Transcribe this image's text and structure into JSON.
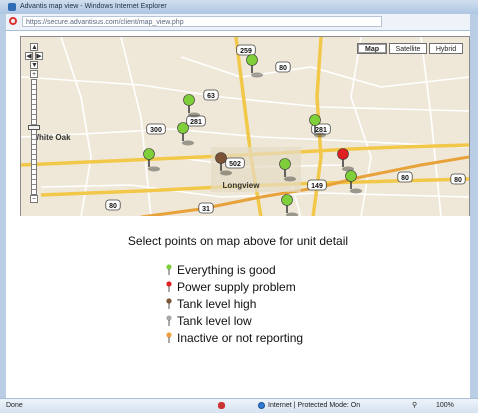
{
  "window": {
    "title": "Advantis map view - Windows Internet Explorer",
    "url": "https://secure.advantisus.com/client/map_view.php"
  },
  "map": {
    "types": [
      "Map",
      "Satellite",
      "Hybrid"
    ],
    "active_type": "Map",
    "zoom_in": "+",
    "zoom_out": "−",
    "labels": [
      {
        "text": "259",
        "kind": "shield"
      },
      {
        "text": "80",
        "kind": "shield"
      },
      {
        "text": "63",
        "kind": "shield"
      },
      {
        "text": "281",
        "kind": "shield"
      },
      {
        "text": "300",
        "kind": "shield"
      },
      {
        "text": "281",
        "kind": "shield"
      },
      {
        "text": "502",
        "kind": "shield"
      },
      {
        "text": "149",
        "kind": "shield"
      },
      {
        "text": "80",
        "kind": "shield"
      },
      {
        "text": "80",
        "kind": "shield"
      },
      {
        "text": "31",
        "kind": "shield"
      },
      {
        "text": "80",
        "kind": "shield"
      },
      {
        "text": "Longview",
        "kind": "city"
      },
      {
        "text": "White Oak",
        "kind": "city"
      }
    ],
    "markers": [
      {
        "status": "good"
      },
      {
        "status": "good"
      },
      {
        "status": "good"
      },
      {
        "status": "good"
      },
      {
        "status": "good"
      },
      {
        "status": "tank_high"
      },
      {
        "status": "good"
      },
      {
        "status": "good"
      },
      {
        "status": "power"
      },
      {
        "status": "good"
      }
    ]
  },
  "content": {
    "prompt": "Select points on map above for unit detail",
    "legend": [
      {
        "label": "Everything is good",
        "color": "#7fcf3a",
        "status": "good"
      },
      {
        "label": "Power supply problem",
        "color": "#e02020",
        "status": "power"
      },
      {
        "label": "Tank level high",
        "color": "#7a5434",
        "status": "tank_high"
      },
      {
        "label": "Tank level low",
        "color": "#a8a8a8",
        "status": "tank_low"
      },
      {
        "label": "Inactive or not reporting",
        "color": "#f0a040",
        "status": "inactive"
      }
    ]
  },
  "status_bar": {
    "left": "Done",
    "zone": "Internet | Protected Mode: On",
    "zoom": "100%"
  }
}
